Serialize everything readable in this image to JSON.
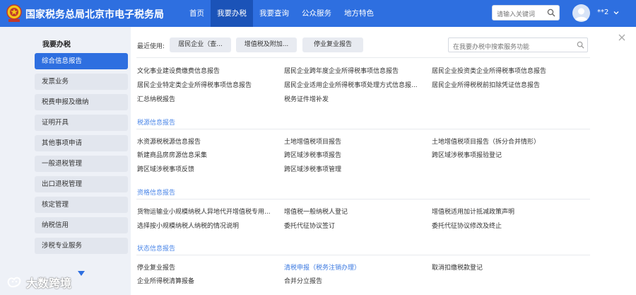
{
  "header": {
    "site_title": "国家税务总局北京市电子税务局",
    "nav": [
      "首页",
      "我要办税",
      "我要查询",
      "公众服务",
      "地方特色"
    ],
    "active_nav_index": 1,
    "search_placeholder": "请输入关键词",
    "user_name": "**2"
  },
  "sidebar": {
    "title": "我要办税",
    "items": [
      "综合信息报告",
      "发票业务",
      "税费申报及缴纳",
      "证明开具",
      "其他事项申请",
      "一般退税管理",
      "出口退税管理",
      "核定管理",
      "纳税信用",
      "涉税专业服务"
    ],
    "active_index": 0
  },
  "watermark": "大数跨境",
  "main": {
    "recent_label": "最近使用:",
    "recent": [
      "居民企业（查...",
      "增值税及附加...",
      "停业复业报告"
    ],
    "search_placeholder": "在我要办税中搜索服务功能",
    "top_links": [
      [
        "文化事业建设费缴费信息报告",
        "居民企业跨年度企业所得税事项信息报告",
        "居民企业投资类企业所得税事项信息报告"
      ],
      [
        "居民企业特定类企业所得税事项信息报告",
        "居民企业适用企业所得税事项处理方式信息报...",
        "居民企业所得税税前扣除凭证信息报告"
      ],
      [
        "汇总纳税报告",
        "税务证件增补发",
        ""
      ]
    ],
    "sections": [
      {
        "title": "税源信息报告",
        "rows": [
          [
            "水资源税税源信息报告",
            "土地增值税项目报告",
            "土地增值税项目报告（拆分合并情形）"
          ],
          [
            "新建商品房房源信息采集",
            "跨区域涉税事项报告",
            "跨区域涉税事项报验登记"
          ],
          [
            "跨区域涉税事项反馈",
            "跨区域涉税事项管理",
            ""
          ]
        ]
      },
      {
        "title": "资格信息报告",
        "rows": [
          [
            "货物运输业小规模纳税人异地代开增值税专用...",
            "增值税一般纳税人登记",
            "增值税适用加计抵减政策声明"
          ],
          [
            "选择按小规模纳税人纳税的情况说明",
            "委托代征协议签订",
            "委托代征协议修改及终止"
          ]
        ]
      },
      {
        "title": "状态信息报告",
        "rows": [
          [
            "停业复业报告",
            "清税申报（税务注销办理）",
            "取消扣缴税款登记"
          ],
          [
            "企业所得税清算报备",
            "合并分立报告",
            ""
          ]
        ]
      }
    ]
  },
  "colors": {
    "header_bg": "#2e6fe0",
    "active_nav_bg": "#1b53b8",
    "sidebar_active": "#2e6fe0",
    "section_title": "#4a86e8",
    "highlight_link": "#3a78e0"
  },
  "icons": [
    "tax-bureau-logo-icon",
    "search-icon",
    "user-avatar-icon",
    "chevron-down-icon",
    "close-icon",
    "scroll-down-arrow-icon",
    "watermark-logo-icon"
  ]
}
